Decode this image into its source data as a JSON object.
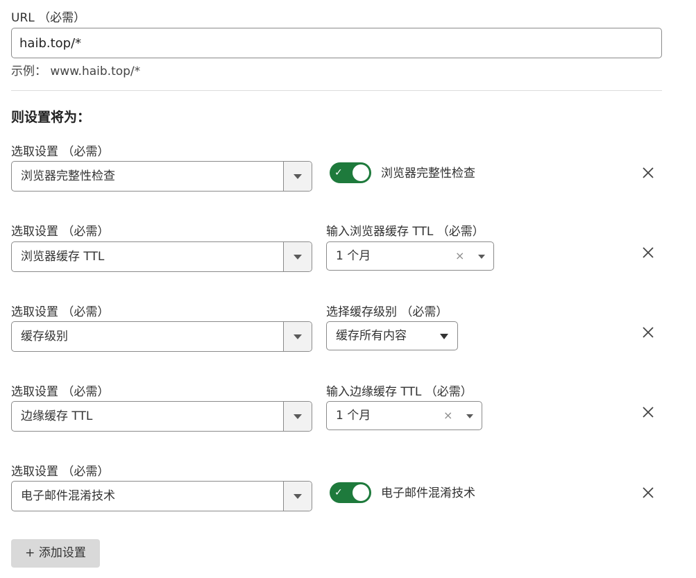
{
  "url_field": {
    "label": "URL （必需）",
    "value": "haib.top/*",
    "hint": "示例： www.haib.top/*"
  },
  "section_title": "则设置将为：",
  "rows": [
    {
      "select_label": "选取设置 （必需）",
      "select_value": "浏览器完整性检查",
      "toggle_on": true,
      "toggle_label": "浏览器完整性检查"
    },
    {
      "select_label": "选取设置 （必需）",
      "select_value": "浏览器缓存 TTL",
      "side_label": "输入浏览器缓存 TTL （必需）",
      "side_value": "1 个月",
      "side_clear": "×"
    },
    {
      "select_label": "选取设置 （必需）",
      "select_value": "缓存级别",
      "side_label": "选择缓存级别 （必需）",
      "side_value": "缓存所有内容"
    },
    {
      "select_label": "选取设置 （必需）",
      "select_value": "边缘缓存 TTL",
      "side_label": "输入边缘缓存 TTL （必需）",
      "side_value": "1 个月",
      "side_clear": "×"
    },
    {
      "select_label": "选取设置 （必需）",
      "select_value": "电子邮件混淆技术",
      "toggle_on": true,
      "toggle_label": "电子邮件混淆技术"
    }
  ],
  "toggle_check": "✓",
  "add_button": "+ 添加设置",
  "colors": {
    "toggle_on": "#1e7a3c",
    "border": "#8a8a8a"
  },
  "icons": [
    "chevron-down-icon",
    "close-icon",
    "check-icon",
    "clear-icon"
  ]
}
